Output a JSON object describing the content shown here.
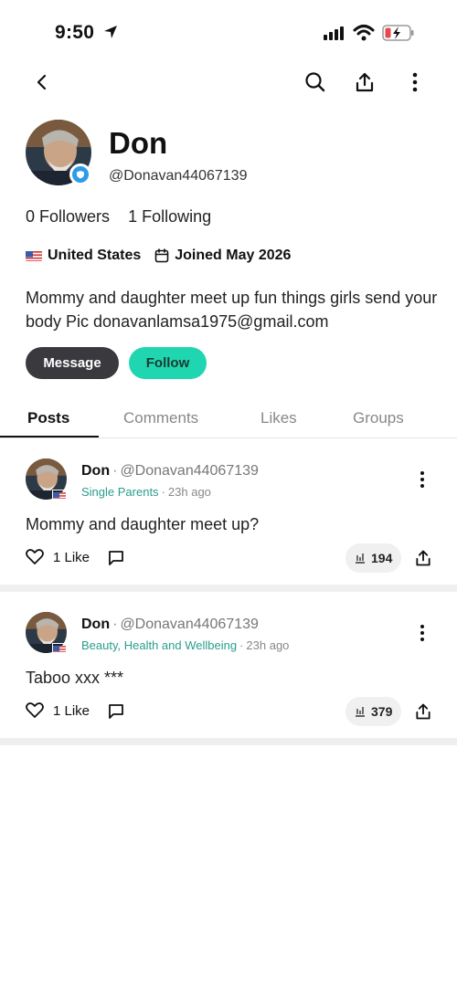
{
  "status_bar": {
    "time": "9:50"
  },
  "nav": {
    "back_icon": "chevron-left-icon",
    "search_icon": "search-icon",
    "share_icon": "share-icon",
    "more_icon": "more-vertical-icon"
  },
  "profile": {
    "name": "Don",
    "handle": "@Donavan44067139",
    "followers_count": "0",
    "followers_label": "Followers",
    "following_count": "1",
    "following_label": "Following",
    "location": "United States",
    "joined": "Joined May 2026",
    "bio": "Mommy and daughter meet up fun things girls send your body Pic donavanlamsa1975@gmail.com",
    "message_label": "Message",
    "follow_label": "Follow"
  },
  "tabs": [
    {
      "label": "Posts",
      "active": true
    },
    {
      "label": "Comments",
      "active": false
    },
    {
      "label": "Likes",
      "active": false
    },
    {
      "label": "Groups",
      "active": false
    }
  ],
  "posts": [
    {
      "author": "Don",
      "handle": "@Donavan44067139",
      "group": "Single Parents",
      "time": "23h ago",
      "text": "Mommy and daughter meet up?",
      "likes": "1 Like",
      "views": "194"
    },
    {
      "author": "Don",
      "handle": "@Donavan44067139",
      "group": "Beauty, Health and Wellbeing",
      "time": "23h ago",
      "text": "Taboo xxx ***",
      "likes": "1 Like",
      "views": "379"
    }
  ],
  "colors": {
    "follow_button": "#20d6b0",
    "message_button": "#3a3a3e",
    "group_link": "#2a9d8f",
    "verified_badge": "#2e9be6"
  }
}
